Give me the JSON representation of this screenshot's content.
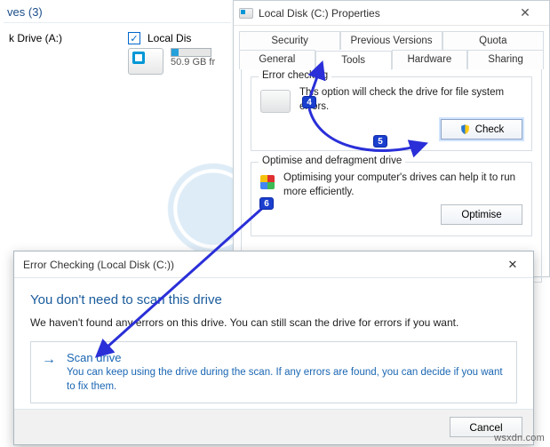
{
  "explorer": {
    "header_prefix": "ves",
    "count_label": "(3)",
    "drive_a": {
      "label": "k Drive (A:)"
    },
    "local_disk": {
      "label": "Local Dis",
      "free_text": "50.9 GB fr"
    }
  },
  "props": {
    "title": "Local Disk (C:) Properties",
    "tabs_row1": [
      "Security",
      "Previous Versions",
      "Quota"
    ],
    "tabs_row2": [
      "General",
      "Tools",
      "Hardware",
      "Sharing"
    ],
    "active_tab_index_row2": 1,
    "error_checking": {
      "legend": "Error checking",
      "text": "This option will check the drive for file system errors.",
      "button": "Check"
    },
    "optimise": {
      "legend": "Optimise and defragment drive",
      "text": "Optimising your computer's drives can help it to run more efficiently.",
      "button": "Optimise"
    }
  },
  "echk": {
    "title": "Error Checking (Local Disk (C:))",
    "heading": "You don't need to scan this drive",
    "subtext": "We haven't found any errors on this drive. You can still scan the drive for errors if you want.",
    "option": {
      "title": "Scan drive",
      "desc": "You can keep using the drive during the scan. If any errors are found, you can decide if you want to fix them."
    },
    "cancel": "Cancel"
  },
  "steps": {
    "s4": "4",
    "s5": "5",
    "s6": "6"
  },
  "watermark": "wsxdn.com"
}
